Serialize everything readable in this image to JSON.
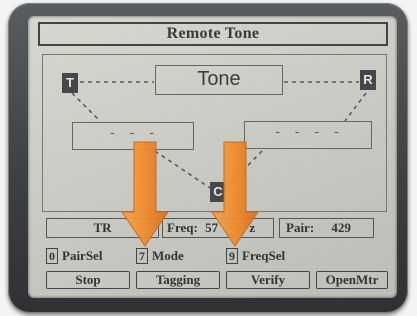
{
  "title": "Remote Tone",
  "nodes": {
    "transmitter": "T",
    "receiver": "R",
    "common": "C"
  },
  "tone_label": "Tone",
  "left_field_value": "- - -",
  "right_field_value": "- - - -",
  "status": {
    "mode": "TR",
    "freq_label": "Freq:",
    "freq_value": "57",
    "freq_tail": "z",
    "pair_label": "Pair:",
    "pair_value": "429"
  },
  "number_keys": [
    {
      "num": "0",
      "label": "PairSel"
    },
    {
      "num": "7",
      "label": "Mode"
    },
    {
      "num": "9",
      "label": "FreqSel"
    }
  ],
  "softkeys": [
    "Stop",
    "Tagging",
    "Verify",
    "OpenMtr"
  ],
  "colors": {
    "lcd": "#c9cac3",
    "bezel": "#3e4144",
    "arrow": "#f08a2c"
  }
}
